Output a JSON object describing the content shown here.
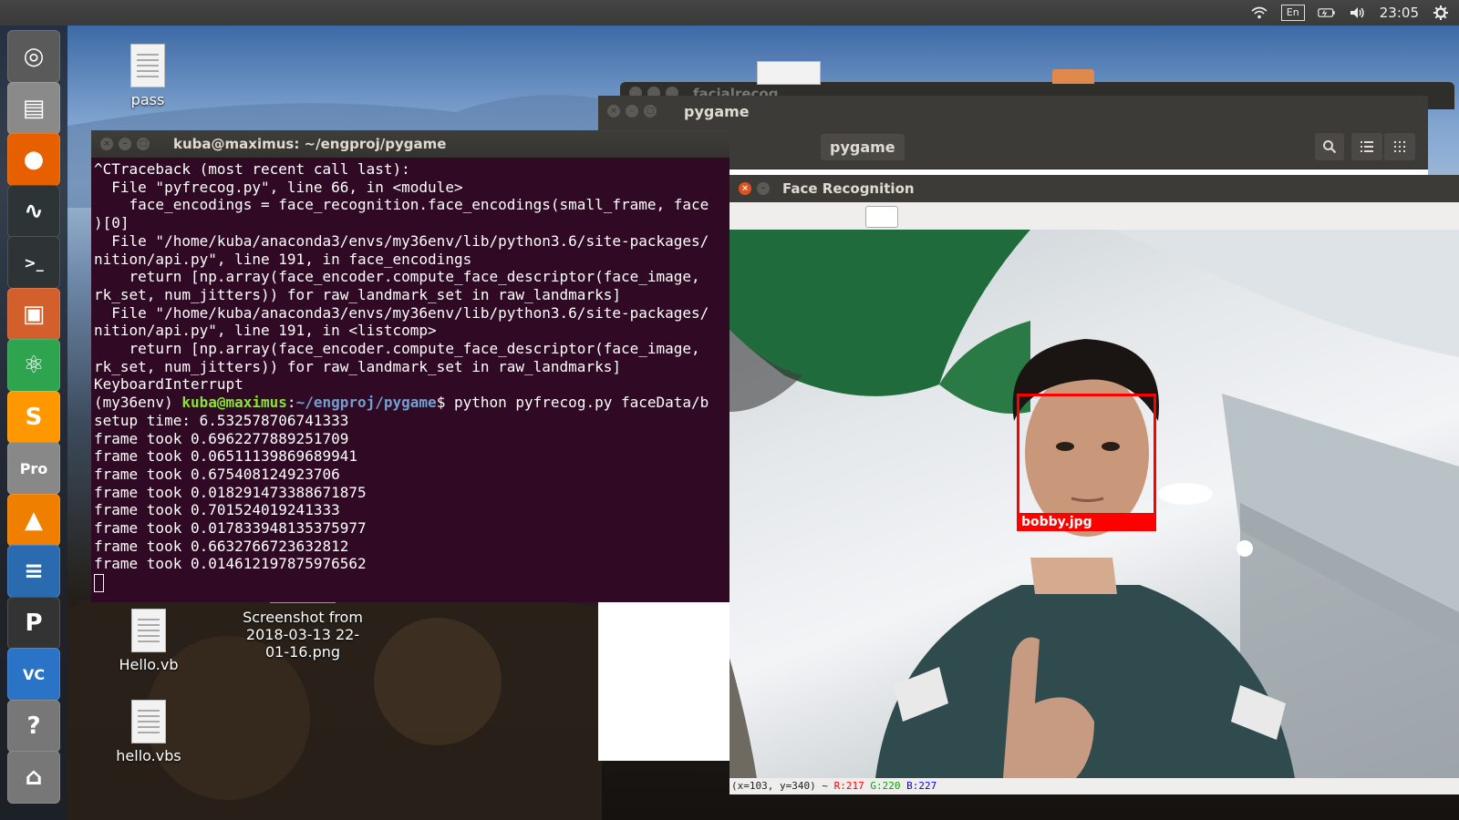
{
  "topbar": {
    "keyboard_layout": "En",
    "clock": "23:05",
    "icons": [
      "wifi-icon",
      "keyboard-icon",
      "battery-icon",
      "volume-icon",
      "gear-icon"
    ]
  },
  "launcher": {
    "items": [
      {
        "name": "ubuntu-dash",
        "glyph": "◎",
        "color": "#5a5a5a"
      },
      {
        "name": "file-manager",
        "glyph": "▤",
        "color": "#8a8a8a"
      },
      {
        "name": "firefox",
        "glyph": "●",
        "color": "#e66000"
      },
      {
        "name": "system-monitor",
        "glyph": "∿",
        "color": "#2d3436"
      },
      {
        "name": "terminal",
        "glyph": ">_",
        "color": "#2e3436"
      },
      {
        "name": "archive-manager",
        "glyph": "▣",
        "color": "#d35f2c"
      },
      {
        "name": "atom",
        "glyph": "⚛",
        "color": "#2ea44f"
      },
      {
        "name": "sublime-text",
        "glyph": "S",
        "color": "#ff9800"
      },
      {
        "name": "google-earth-pro",
        "glyph": "Pro",
        "color": "#888"
      },
      {
        "name": "vlc",
        "glyph": "▲",
        "color": "#f07f00"
      },
      {
        "name": "mono-develop",
        "glyph": "≡",
        "color": "#2a6bb0"
      },
      {
        "name": "pgadmin",
        "glyph": "P",
        "color": "#333"
      },
      {
        "name": "visual-code",
        "glyph": "VC",
        "color": "#2a73c6"
      },
      {
        "name": "help",
        "glyph": "?",
        "color": "#777"
      },
      {
        "name": "trash",
        "glyph": "⌂",
        "color": "#777"
      }
    ]
  },
  "desktop": {
    "icons": [
      {
        "label": "pass"
      },
      {
        "label": "Hello.vb"
      },
      {
        "label": "Screenshot from 2018-03-13 22-01-16.png"
      },
      {
        "label": "hello.vbs"
      }
    ]
  },
  "windows": {
    "back_title": "facialrecog",
    "pygame_title": "pygame",
    "pygame_tab": "pygame"
  },
  "terminal": {
    "title": "kuba@maximus: ~/engproj/pygame",
    "lines": [
      "^CTraceback (most recent call last):",
      "  File \"pyfrecog.py\", line 66, in <module>",
      "    face_encodings = face_recognition.face_encodings(small_frame, face",
      ")[0]",
      "  File \"/home/kuba/anaconda3/envs/my36env/lib/python3.6/site-packages/",
      "nition/api.py\", line 191, in face_encodings",
      "    return [np.array(face_encoder.compute_face_descriptor(face_image,",
      "rk_set, num_jitters)) for raw_landmark_set in raw_landmarks]",
      "  File \"/home/kuba/anaconda3/envs/my36env/lib/python3.6/site-packages/",
      "nition/api.py\", line 191, in <listcomp>",
      "    return [np.array(face_encoder.compute_face_descriptor(face_image,",
      "rk_set, num_jitters)) for raw_landmark_set in raw_landmarks]",
      "KeyboardInterrupt"
    ],
    "prompt": {
      "env": "(my36env) ",
      "user": "kuba@maximus",
      "path": "~/engproj/pygame",
      "command": "$ python pyfrecog.py faceData/b"
    },
    "output": [
      "setup time: 6.532578706741333",
      "frame took 0.6962277889251709",
      "frame took 0.06511139869689941",
      "frame took 0.675408124923706",
      "frame took 0.018291473388671875",
      "frame took 0.701524019241333",
      "frame took 0.017833948135375977",
      "frame took 0.6632766723632812",
      "frame took 0.014612197875976562"
    ]
  },
  "face_window": {
    "title": "Face Recognition",
    "face_label": "bobby.jpg",
    "status": {
      "coords": "(x=103, y=340) ~ ",
      "r": "R:217",
      "g": "G:220",
      "b": "B:227",
      "r_color": "#ff0000",
      "g_color": "#00aa00",
      "b_color": "#0000ff"
    }
  }
}
